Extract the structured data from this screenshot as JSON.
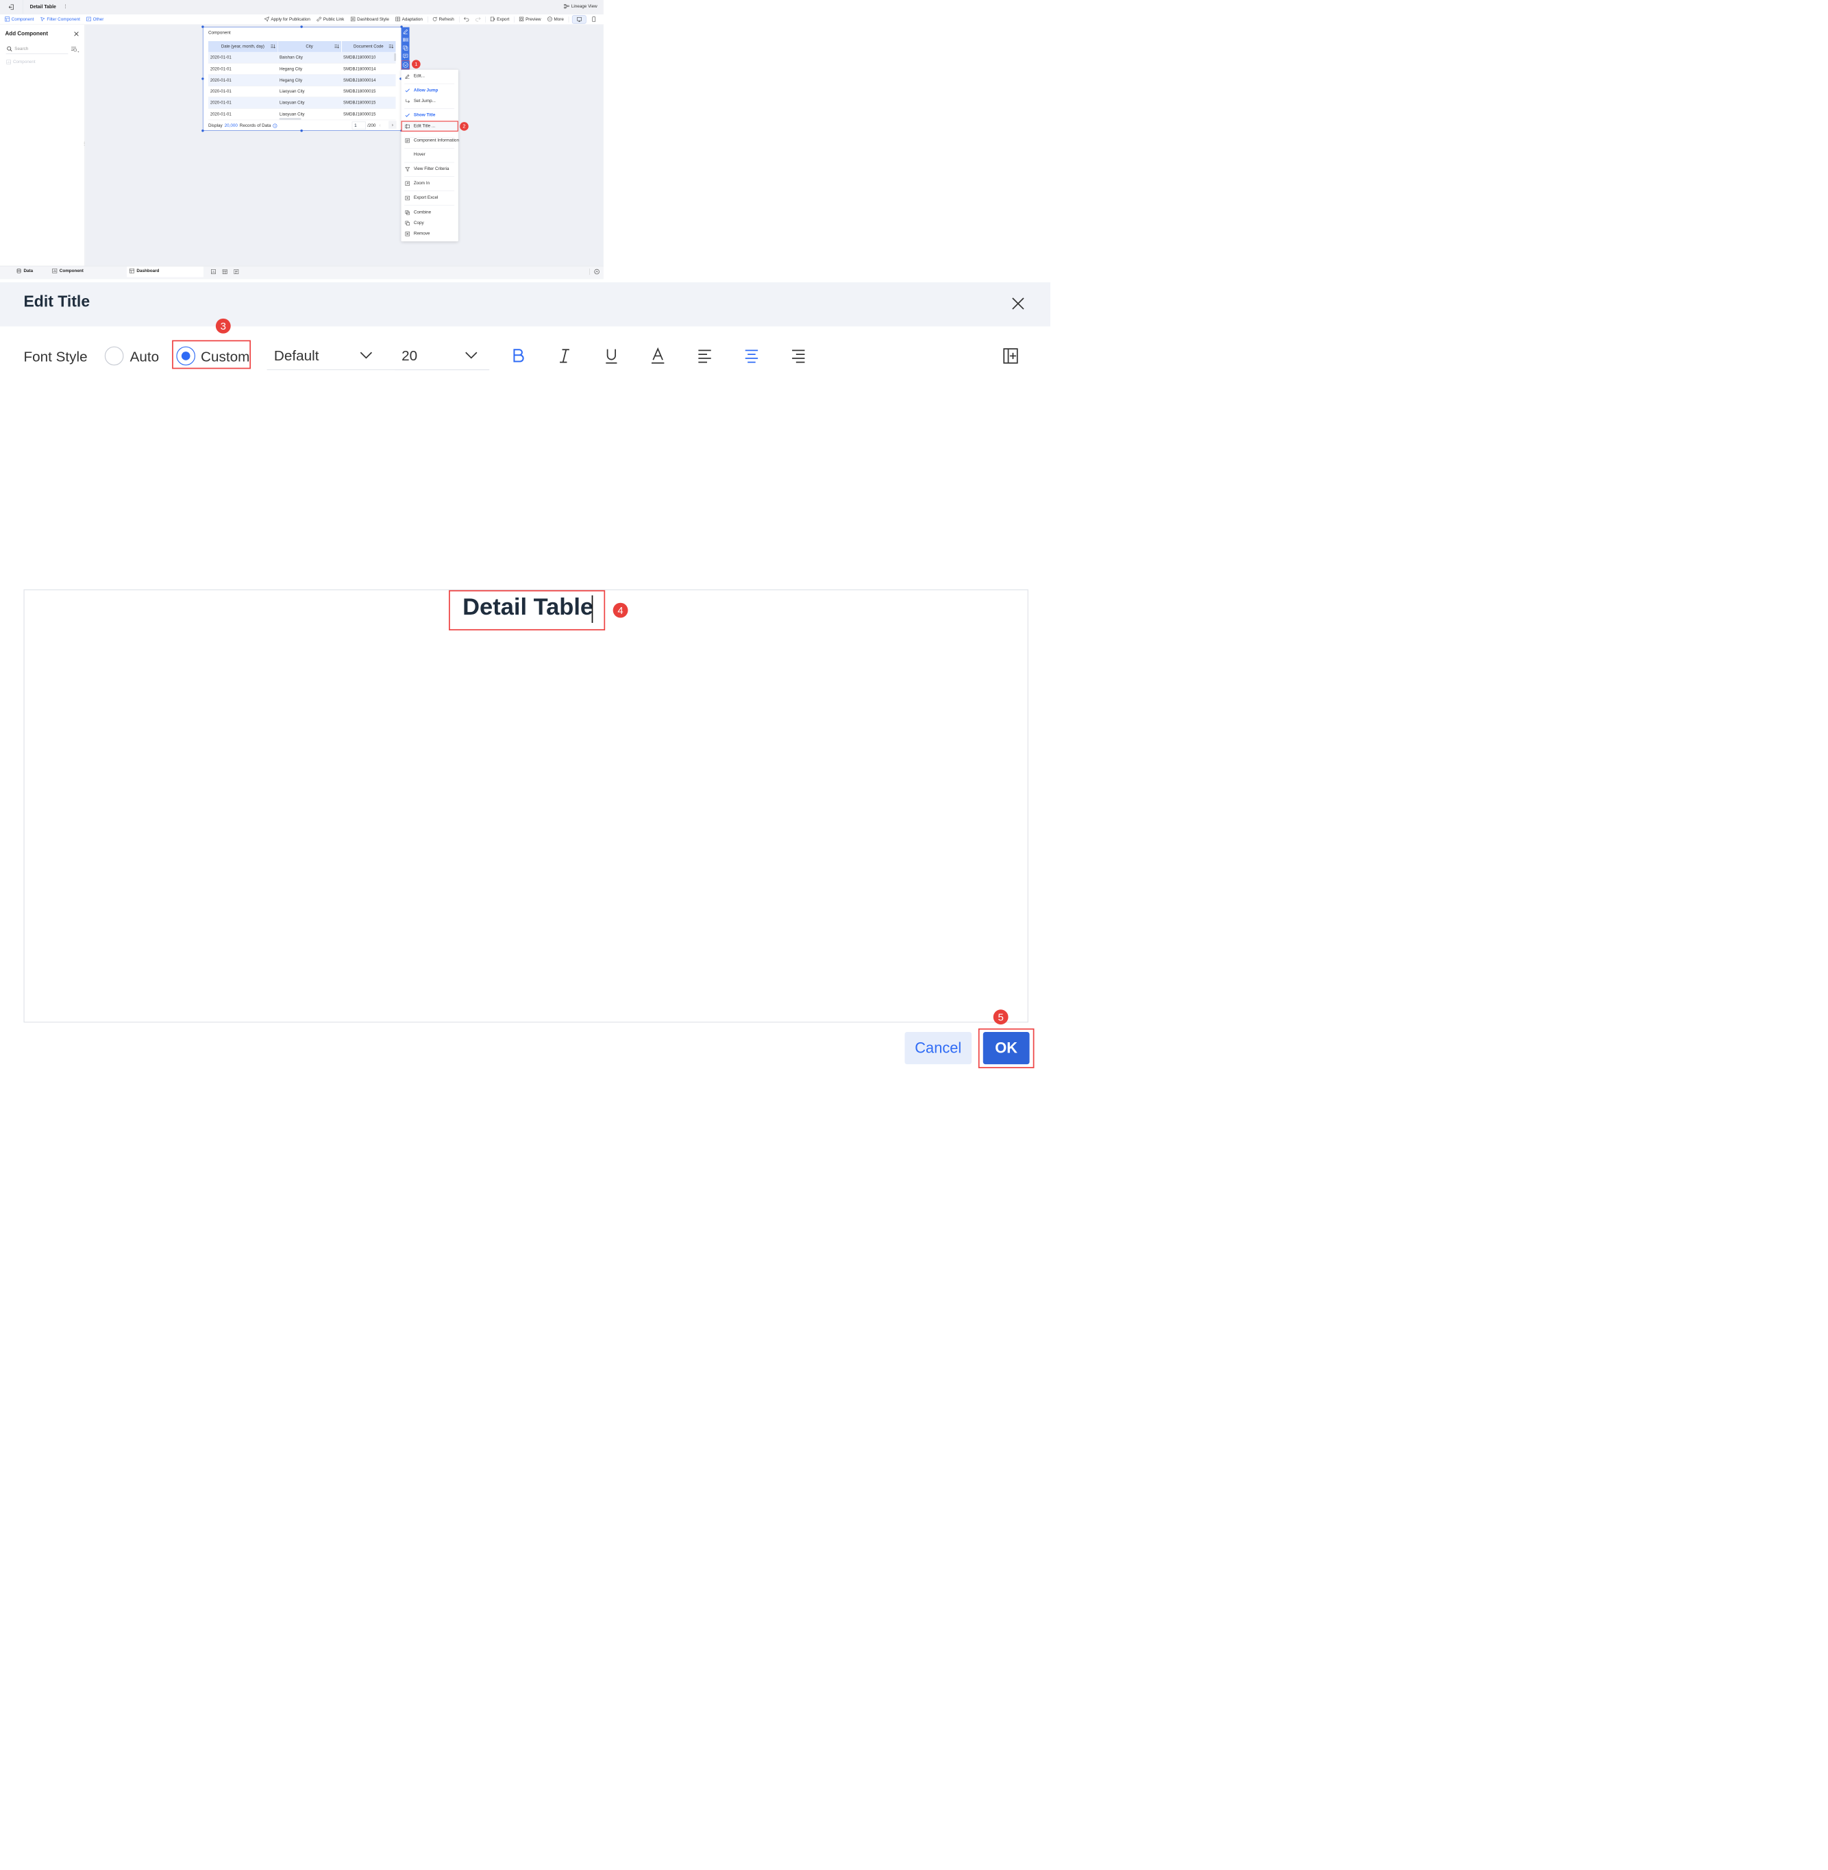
{
  "titlebar": {
    "title": "Detail Table",
    "lineage": "Lineage View"
  },
  "toolbar": {
    "left": [
      "Component",
      "Filter Component",
      "Other"
    ],
    "apply": "Apply for Publication",
    "public_link": "Public Link",
    "dashboard_style": "Dashboard Style",
    "adaptation": "Adaptation",
    "refresh": "Refresh",
    "export": "Export",
    "preview": "Preview",
    "more": "More"
  },
  "sidebar": {
    "title": "Add Component",
    "search_placeholder": "Search",
    "item": "Component"
  },
  "widget": {
    "title": "Component",
    "columns": [
      "Date (year, month, day)",
      "City",
      "Document Code"
    ],
    "rows": [
      [
        "2020-01-01",
        "Baishan City",
        "SMDBJ18000010"
      ],
      [
        "2020-01-01",
        "Hegang City",
        "SMDBJ18000014"
      ],
      [
        "2020-01-01",
        "Hegang City",
        "SMDBJ18000014"
      ],
      [
        "2020-01-01",
        "Liaoyuan City",
        "SMDBJ18000015"
      ],
      [
        "2020-01-01",
        "Liaoyuan City",
        "SMDBJ18000015"
      ],
      [
        "2020-01-01",
        "Liaoyuan City",
        "SMDBJ18000015"
      ]
    ],
    "footer_display": "Display",
    "footer_count": "20,000",
    "footer_records": "Records of Data",
    "page": "1",
    "page_total": "/200"
  },
  "menu": {
    "edit": "Edit...",
    "allow_jump": "Allow Jump",
    "set_jump": "Set Jump...",
    "show_title": "Show Title",
    "edit_title": "Edit Title ...",
    "component_information": "Component Information",
    "hover": "Hover",
    "view_filter": "View Filter Criteria",
    "zoom_in": "Zoom In",
    "export_excel": "Export Excel",
    "combine": "Combine",
    "copy": "Copy",
    "remove": "Remove"
  },
  "bottom_tabs": {
    "data": "Data",
    "component": "Component",
    "dashboard": "Dashboard"
  },
  "badges": [
    "1",
    "2",
    "3",
    "4",
    "5"
  ],
  "dialog": {
    "title": "Edit Title",
    "font_style": "Font Style",
    "auto": "Auto",
    "custom": "Custom",
    "selected_style": "Custom",
    "font": "Default",
    "size": "20",
    "text": "Detail Table",
    "cancel": "Cancel",
    "ok": "OK"
  },
  "colors": {
    "accent": "#2f6bf5",
    "highlight": "#e44444",
    "badge": "#e9403b"
  }
}
